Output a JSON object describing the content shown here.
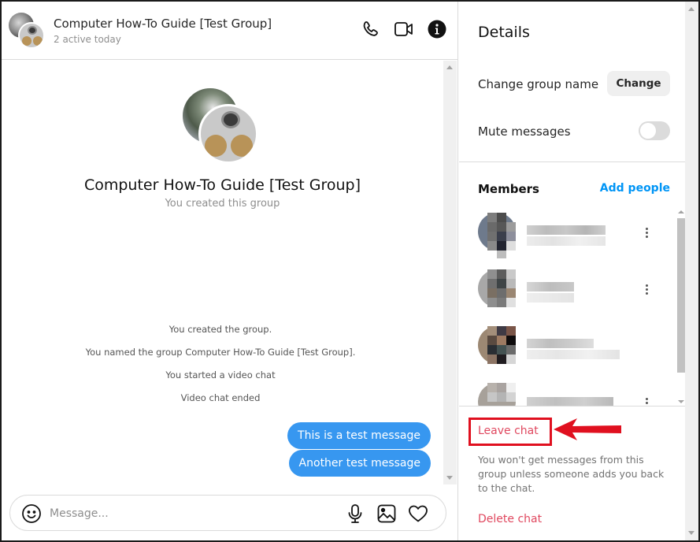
{
  "chat": {
    "title": "Computer How-To Guide [Test Group]",
    "status": "2 active today",
    "header_icons": [
      "phone-icon",
      "video-camera-icon",
      "info-icon"
    ],
    "group_title": "Computer How-To Guide [Test Group]",
    "group_subtitle": "You created this group",
    "system_messages": [
      "You created the group.",
      "You named the group Computer How-To Guide [Test Group].",
      "You started a video chat",
      "Video chat ended"
    ],
    "messages": [
      {
        "text": "This is a test message",
        "from": "me"
      },
      {
        "text": "Another test message",
        "from": "me"
      }
    ],
    "composer": {
      "placeholder": "Message...",
      "value": "",
      "icons": [
        "emoji-icon",
        "microphone-icon",
        "image-icon",
        "heart-icon"
      ]
    }
  },
  "details": {
    "title": "Details",
    "change_group_name_label": "Change group name",
    "change_button": "Change",
    "mute_label": "Mute messages",
    "mute_enabled": false,
    "members_label": "Members",
    "add_people": "Add people",
    "members": [
      {
        "name": "[blurred]",
        "username": "[blurred]"
      },
      {
        "name": "[blurred]",
        "username": "[blurred]"
      },
      {
        "name": "[blurred]",
        "username": "[blurred]"
      },
      {
        "name": "[blurred]",
        "username": "[blurred]"
      }
    ],
    "leave_chat": "Leave chat",
    "leave_description": "You won't get messages from this group unless someone adds you back to the chat.",
    "delete_chat": "Delete chat"
  },
  "colors": {
    "accent_blue": "#3797f0",
    "link_blue": "#0095f6",
    "danger": "#e0485f",
    "annotation_red": "#e0101f"
  }
}
